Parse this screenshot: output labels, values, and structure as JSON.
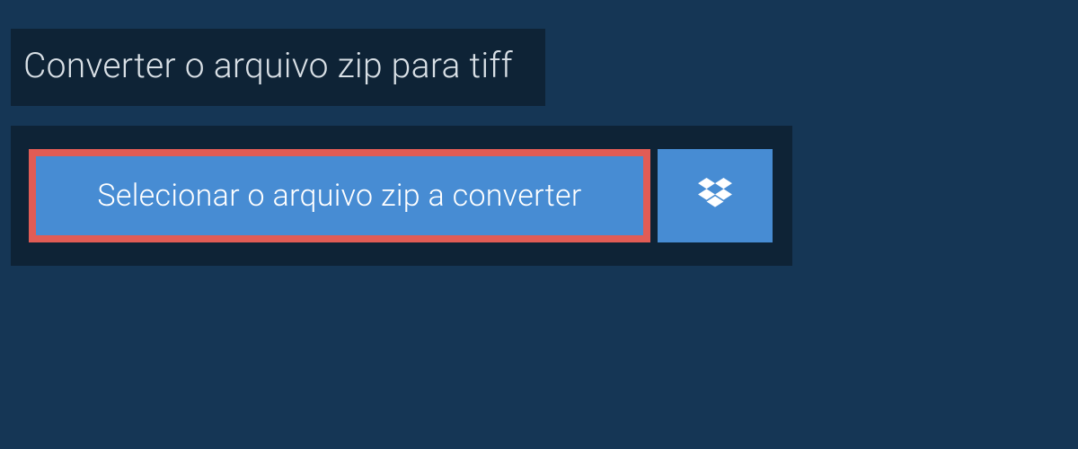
{
  "heading": {
    "text": "Converter o arquivo zip para tiff"
  },
  "main": {
    "select_button_label": "Selecionar o arquivo zip a converter"
  },
  "colors": {
    "highlight_border": "#e15c55",
    "button_bg": "#478cd3",
    "panel_bg": "#0e2336",
    "page_bg": "#153655"
  }
}
